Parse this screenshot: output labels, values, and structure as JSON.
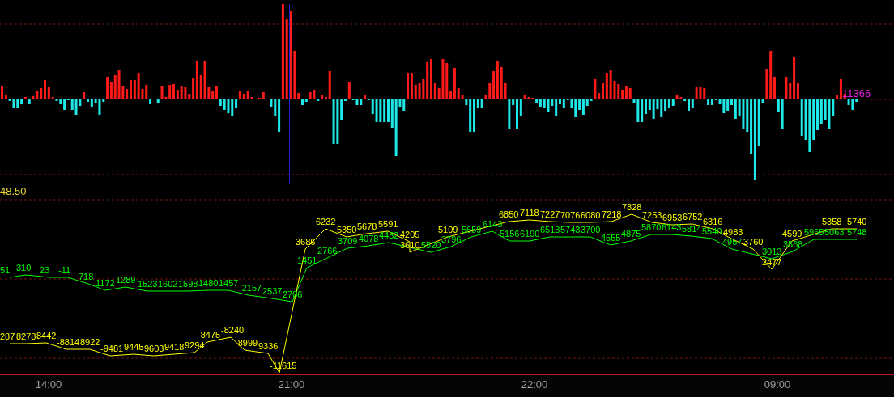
{
  "histogram_panel": {
    "last_value": "11366"
  },
  "flow_panel": {
    "scale_label": "48.50",
    "series": [
      {
        "color": "#00ff00",
        "labels": [
          "51",
          "310",
          "23",
          "-11",
          "718",
          "1172",
          "1289",
          "1523",
          "1602",
          "1598",
          "1480",
          "1457",
          "-2157",
          "2537",
          "2706",
          "1451",
          "2766",
          "3709",
          "4078",
          "4482",
          "5520",
          "3796",
          "5659",
          "6143",
          "5156",
          "6190",
          "6513",
          "5743",
          "3700",
          "4555",
          "4875",
          "5870",
          "6143",
          "5814",
          "5540",
          "4957",
          "3013",
          "3568",
          "5965",
          "5063",
          "5748"
        ]
      },
      {
        "color": "#ffff00",
        "labels": [
          "287",
          "8278",
          "8442",
          "-8814",
          "8922",
          "-9481",
          "9445",
          "9603",
          "9418",
          "9294",
          "-8475",
          "-8240",
          "-8999",
          "9336",
          "-11615",
          "3686",
          "6232",
          "5350",
          "5678",
          "5591",
          "4205",
          "3610",
          "5109",
          "6850",
          "7118",
          "7227",
          "7076",
          "6080",
          "7218",
          "7828",
          "7253",
          "6953",
          "6752",
          "6316",
          "4983",
          "3760",
          "2477",
          "4599",
          "5358",
          "5740"
        ]
      }
    ]
  },
  "time_axis": [
    "14:00",
    "21:00",
    "22:00",
    "09:00"
  ]
}
